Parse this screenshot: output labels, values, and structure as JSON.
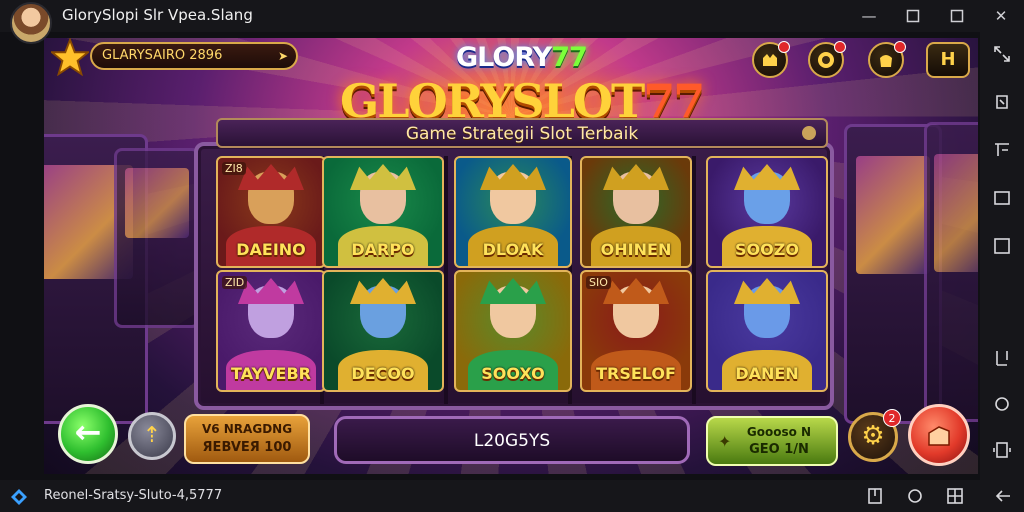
{
  "window": {
    "title": "GlorySlopi Slr Vpea.Slang",
    "minimize": "—",
    "maximize": "☐",
    "close": "✕"
  },
  "game": {
    "brand_top": "GLORY",
    "brand_top_num": "77",
    "brand_main": "GLORYSLOT",
    "brand_main_num": "77",
    "subtitle": "Game Strategii Slot Terbaik",
    "balance": "GLARYSAIRO 2896",
    "balance_arrow": "➤",
    "hud_h": "H",
    "reels": [
      [
        {
          "tag": "ZI8",
          "corner": "",
          "name": "DAEINO"
        },
        {
          "tag": "ZID",
          "corner": "",
          "name": "TAYVEBR"
        }
      ],
      [
        {
          "tag": "",
          "corner": "",
          "name": "DARPO"
        },
        {
          "tag": "",
          "corner": "",
          "name": "DECOO"
        }
      ],
      [
        {
          "tag": "",
          "corner": "",
          "name": "DLOAK"
        },
        {
          "tag": "",
          "corner": "",
          "name": "SOOXO"
        }
      ],
      [
        {
          "tag": "",
          "corner": "",
          "name": "OHINEN"
        },
        {
          "tag": "SIO",
          "corner": "",
          "name": "TRSELOF"
        }
      ],
      [
        {
          "tag": "",
          "corner": "",
          "name": "SOOZO"
        },
        {
          "tag": "",
          "corner": "",
          "name": "DANEN"
        }
      ]
    ],
    "bottom": {
      "back_label": "←",
      "up_label": "⇡",
      "bet_line1": "V6 NRAGDNG",
      "bet_line2": "ЯEBVEЯ 100",
      "center_label": "L20G5YS",
      "right_line1": "Goooso N",
      "right_line2": "GEO 1/N",
      "settings_label": "⚙",
      "settings_badge": "2"
    }
  },
  "status": {
    "text": "Reonel-Sratsy-Sluto-4,5777"
  },
  "colors": {
    "brand_gold": "#ffd23a",
    "brand_green": "#7cff3a",
    "frame_gold": "#d9a94a",
    "back_green": "#2fbf2f",
    "spin_red": "#e23a2a"
  }
}
